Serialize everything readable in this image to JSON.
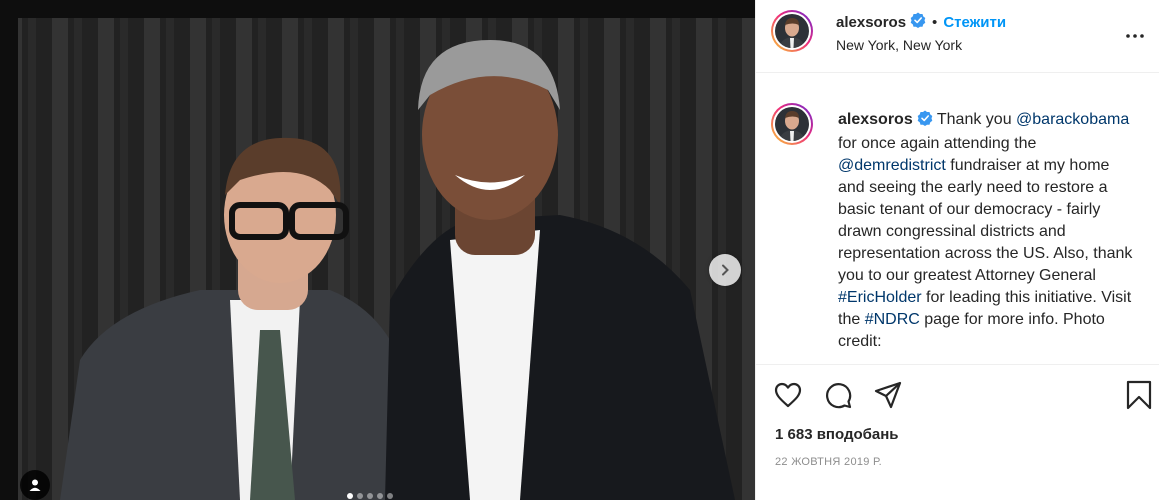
{
  "post": {
    "photo_alt": "",
    "carousel": {
      "count": 5,
      "active_index": 0
    }
  },
  "header": {
    "username": "alexsoros",
    "separator": "•",
    "follow_label": "Стежити",
    "location": "New York, New York"
  },
  "caption": {
    "username": "alexsoros",
    "text_1": " Thank you ",
    "mention_1": "@barackobama",
    "text_2": " for once again attending the ",
    "mention_2": "@demredistrict",
    "text_3": " fundraiser at my home and seeing the early need to restore a basic tenant of our democracy - fairly drawn congressinal districts and representation across the US. Also, thank you to our greatest Attorney General ",
    "hashtag_1": "#EricHolder",
    "text_4": " for leading this initiative. Visit the ",
    "hashtag_2": "#NDRC",
    "text_5": " page for more info. Photo credit: "
  },
  "stats": {
    "likes": "1 683 вподобань",
    "date": "22 ЖОВТНЯ 2019 Р."
  },
  "icons": {
    "verified": "verified-badge-icon",
    "more": "more-options-icon",
    "like": "heart-icon",
    "comment": "comment-icon",
    "share": "share-icon",
    "save": "bookmark-icon",
    "next": "chevron-right-icon",
    "tag": "user-tag-icon"
  },
  "colors": {
    "link": "#00376b",
    "follow": "#0095f6",
    "verified": "#3897f0",
    "muted": "#8e8e8e"
  }
}
